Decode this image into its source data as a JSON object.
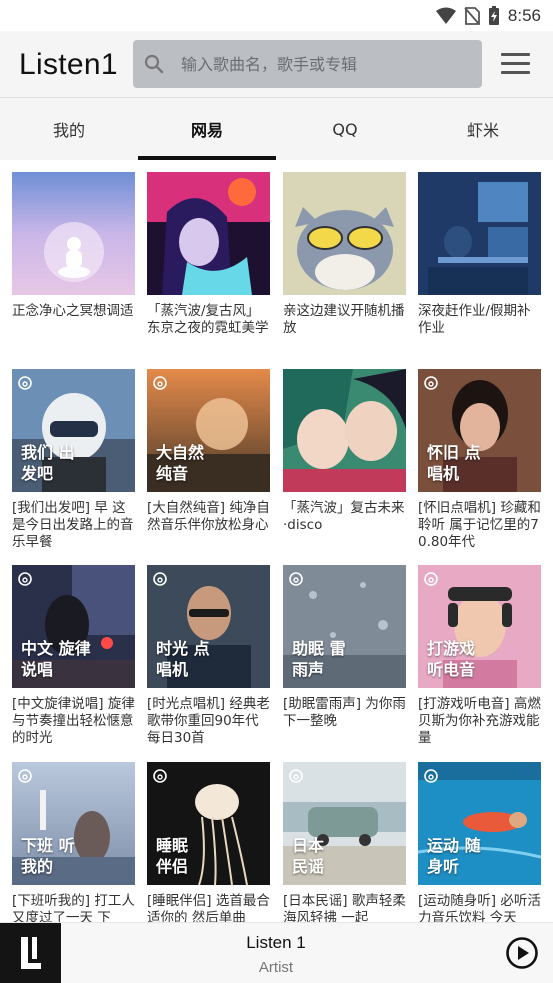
{
  "status": {
    "time": "8:56"
  },
  "app": {
    "title": "Listen1"
  },
  "search": {
    "placeholder": "输入歌曲名，歌手或专辑"
  },
  "tabs": [
    {
      "label": "我的",
      "active": false
    },
    {
      "label": "网易",
      "active": true
    },
    {
      "label": "QQ",
      "active": false
    },
    {
      "label": "虾米",
      "active": false
    }
  ],
  "playlists": [
    {
      "title": "正念净心之冥想调适",
      "overlay": ""
    },
    {
      "title": "「蒸汽波/复古风」东京之夜的霓虹美学",
      "overlay": ""
    },
    {
      "title": "亲这边建议开随机播放",
      "overlay": ""
    },
    {
      "title": "深夜赶作业/假期补作业",
      "overlay": ""
    },
    {
      "title": "[我们出发吧] 早 这是今日出发路上的音乐早餐",
      "overlay": "我们 出发吧"
    },
    {
      "title": "[大自然纯音] 纯净自然音乐伴你放松身心",
      "overlay": "大自然 纯音"
    },
    {
      "title": "「蒸汽波」复古未来·disco",
      "overlay": ""
    },
    {
      "title": "[怀旧点唱机] 珍藏和聆听 属于记忆里的70.80年代",
      "overlay": "怀旧 点唱机"
    },
    {
      "title": "[中文旋律说唱] 旋律与节奏撞出轻松惬意的时光",
      "overlay": "中文 旋律说唱"
    },
    {
      "title": "[时光点唱机] 经典老歌带你重回90年代 每日30首",
      "overlay": "时光 点唱机"
    },
    {
      "title": "[助眠雷雨声] 为你雨下一整晚",
      "overlay": "助眠 雷雨声"
    },
    {
      "title": "[打游戏听电音] 高燃贝斯为你补充游戏能量",
      "overlay": "打游戏 听电音"
    },
    {
      "title": "[下班听我的] 打工人又度过了一天 下",
      "overlay": "下班 听我的"
    },
    {
      "title": "[睡眠伴侣] 选首最合适你的 然后单曲",
      "overlay": "睡眠 伴侣"
    },
    {
      "title": "[日本民谣] 歌声轻柔 海风轻拂 一起",
      "overlay": "日本 民谣"
    },
    {
      "title": "[运动随身听] 必听活力音乐饮料 今天",
      "overlay": "运动 随身听"
    }
  ],
  "player": {
    "title": "Listen 1",
    "artist": "Artist"
  },
  "colors": {
    "accent": "#111111",
    "search_bg": "#bbbec3",
    "header_bg": "#f5f5f5"
  }
}
